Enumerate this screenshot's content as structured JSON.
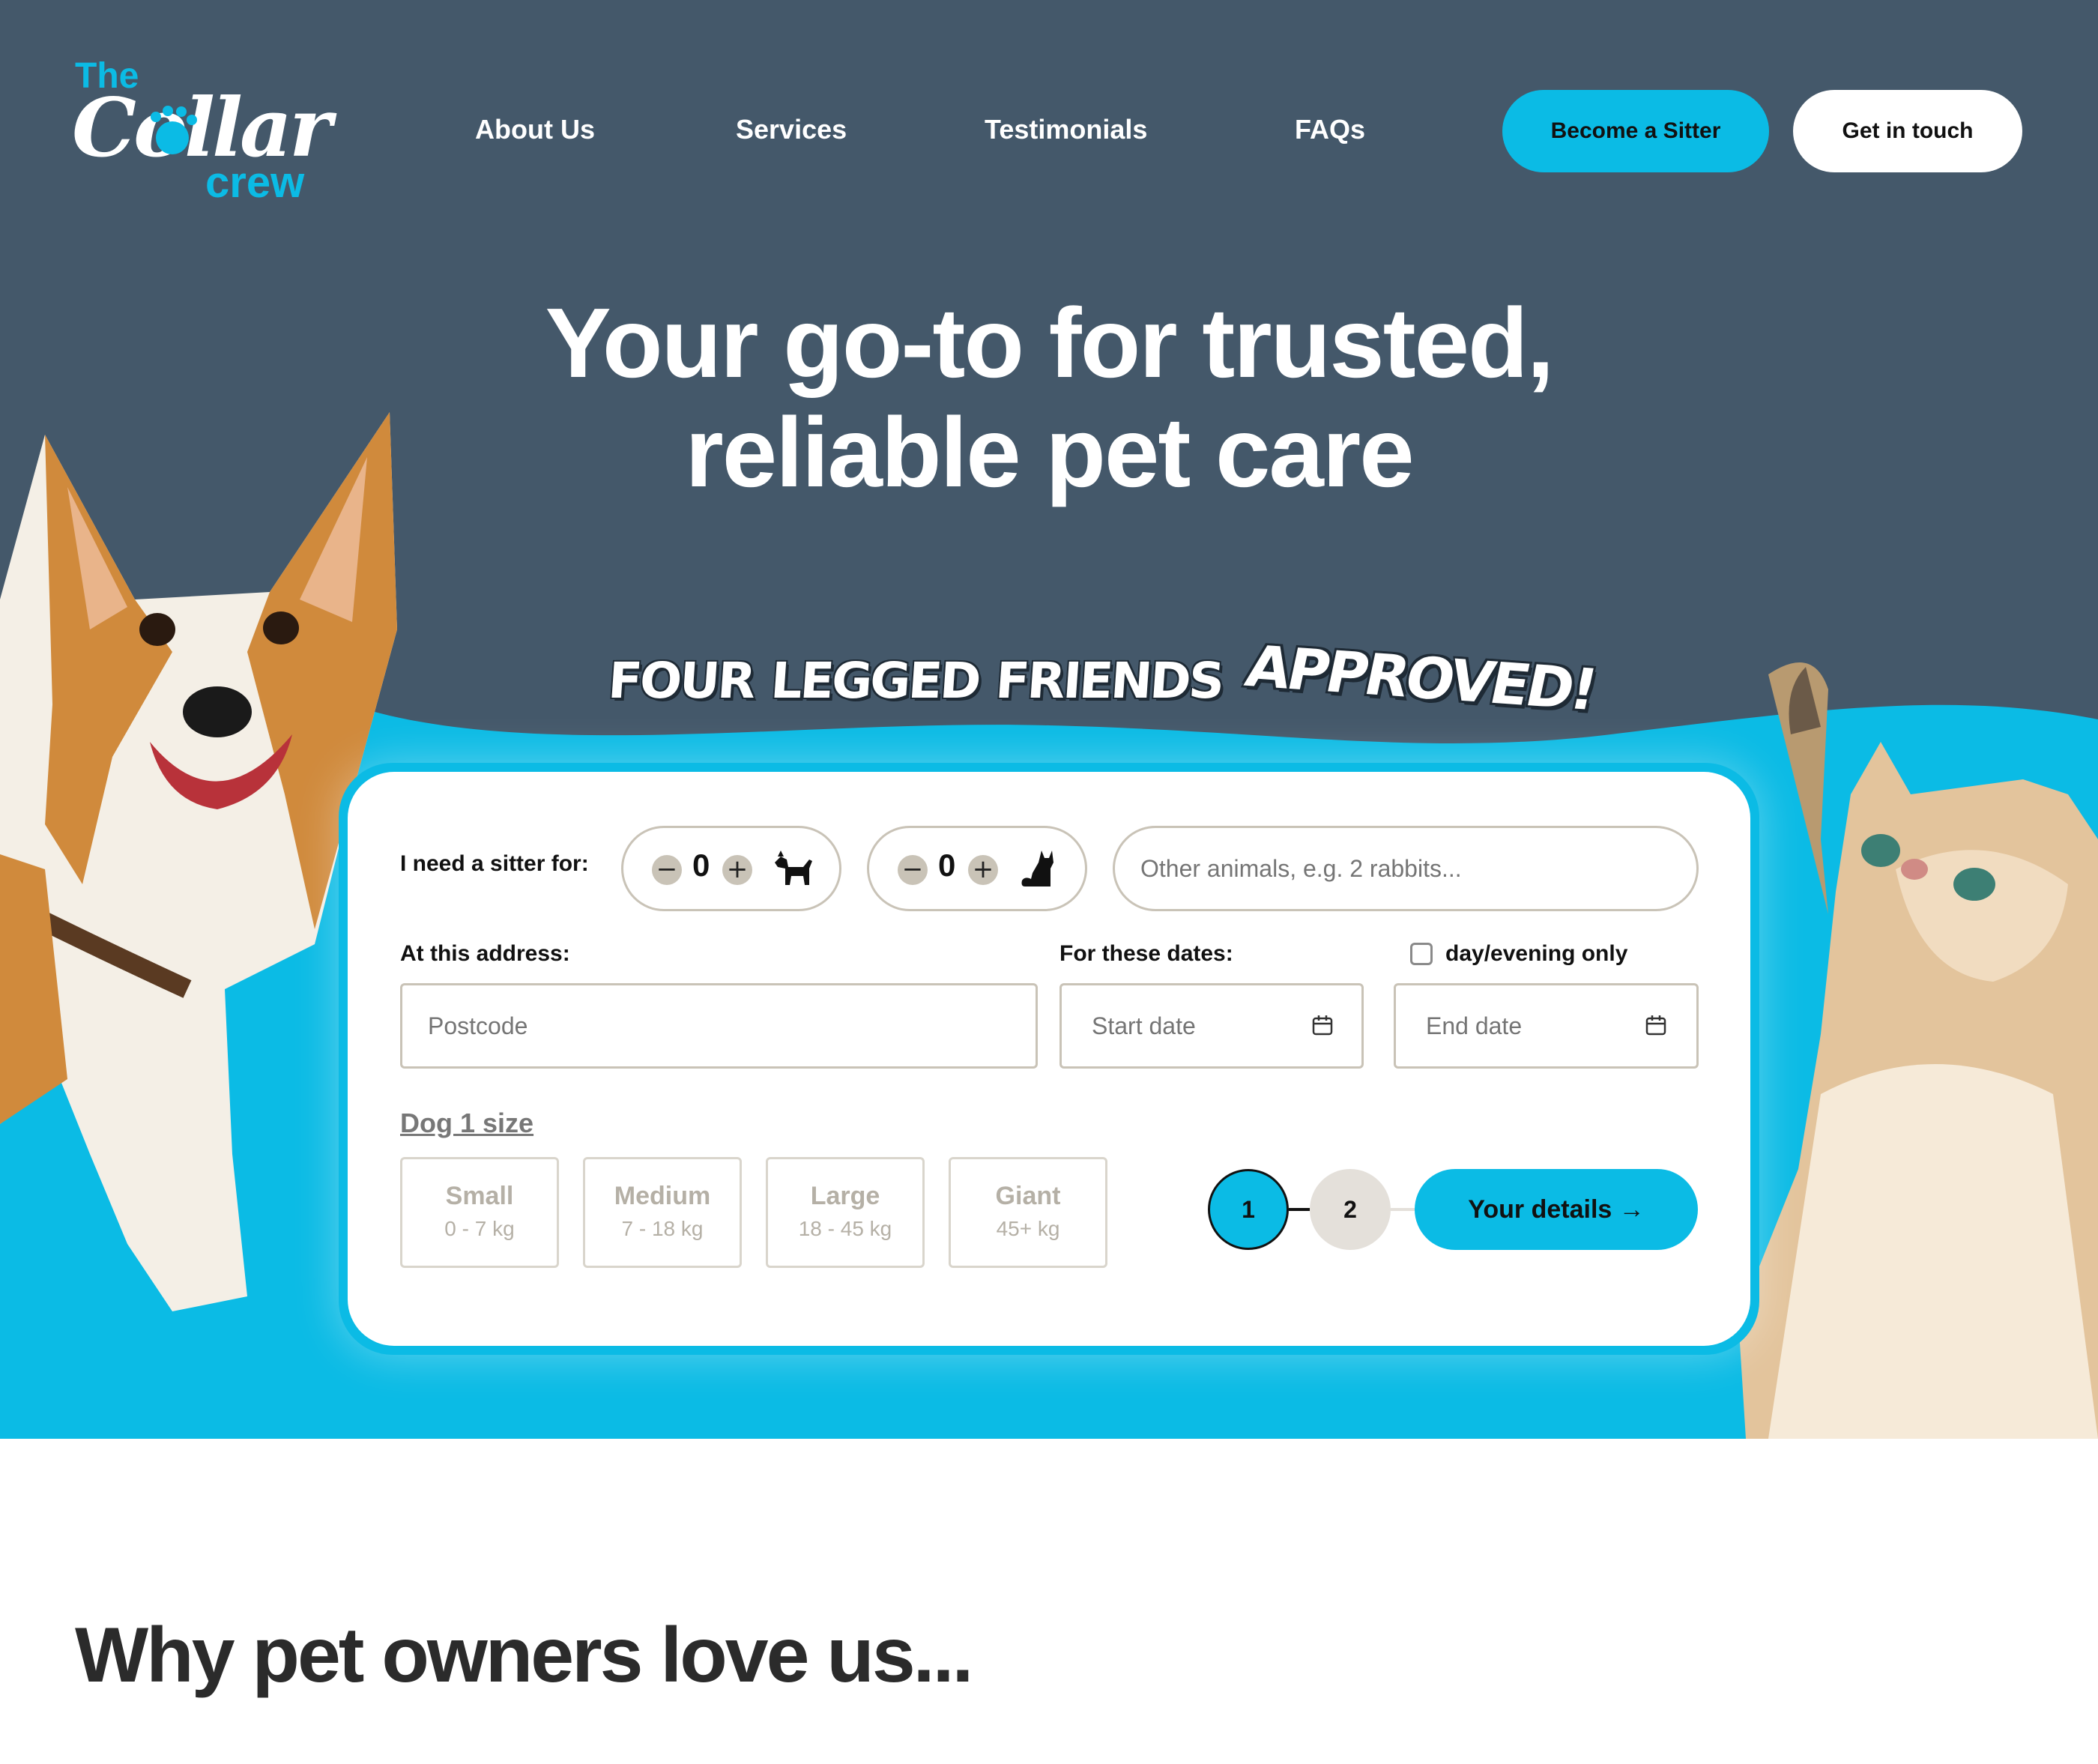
{
  "logo": {
    "the": "The",
    "collar": "Collar",
    "crew": "crew"
  },
  "nav": {
    "links": [
      "About Us",
      "Services",
      "Testimonials",
      "FAQs"
    ],
    "become_sitter": "Become a Sitter",
    "get_in_touch": "Get in touch"
  },
  "hero": {
    "title_line1": "Your go-to for trusted,",
    "title_line2": "reliable pet care",
    "tagline_parts": [
      "FOUR",
      "LEGGED",
      "FRIENDS"
    ],
    "tagline_approved": "APPROVED!"
  },
  "form": {
    "sitter_for_label": "I need a sitter for:",
    "dog_count": "0",
    "cat_count": "0",
    "minus": "−",
    "plus": "+",
    "other_animals_placeholder": "Other animals, e.g. 2 rabbits...",
    "address_label": "At this address:",
    "postcode_placeholder": "Postcode",
    "dates_label": "For these dates:",
    "day_evening_label": "day/evening only",
    "day_evening_checked": false,
    "start_date_placeholder": "Start date",
    "end_date_placeholder": "End date",
    "dog_size_title": "Dog 1 size",
    "sizes": [
      {
        "name": "Small",
        "range": "0 - 7 kg"
      },
      {
        "name": "Medium",
        "range": "7 - 18 kg"
      },
      {
        "name": "Large",
        "range": "18 - 45 kg"
      },
      {
        "name": "Giant",
        "range": "45+ kg"
      }
    ],
    "steps": [
      "1",
      "2"
    ],
    "active_step": "1",
    "next_button": "Your details →"
  },
  "why": {
    "title": "Why pet owners love us..."
  },
  "colors": {
    "hero_bg": "#44586a",
    "accent": "#0bbbe5",
    "white": "#ffffff",
    "border": "#c9c3b7"
  },
  "icons": [
    "paw-icon",
    "dog-icon",
    "cat-icon",
    "calendar-icon",
    "arrow-right-icon"
  ]
}
